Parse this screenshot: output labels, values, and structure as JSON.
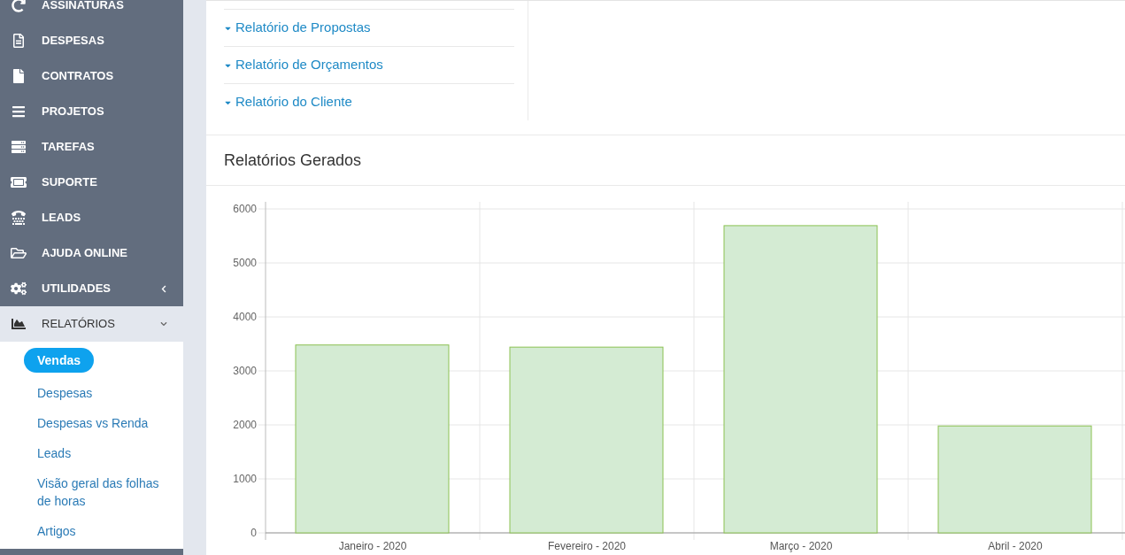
{
  "sidebar": {
    "items": [
      {
        "label": "ASSINATURAS",
        "kind": "link",
        "selected": false
      },
      {
        "label": "DESPESAS",
        "kind": "link",
        "selected": false
      },
      {
        "label": "CONTRATOS",
        "kind": "link",
        "selected": false
      },
      {
        "label": "PROJETOS",
        "kind": "link",
        "selected": false
      },
      {
        "label": "TAREFAS",
        "kind": "link",
        "selected": false
      },
      {
        "label": "SUPORTE",
        "kind": "link",
        "selected": false
      },
      {
        "label": "LEADS",
        "kind": "link",
        "selected": false
      },
      {
        "label": "AJUDA ONLINE",
        "kind": "link",
        "selected": false
      },
      {
        "label": "UTILIDADES",
        "kind": "group",
        "selected": false,
        "expanded": false
      },
      {
        "label": "RELATÓRIOS",
        "kind": "group",
        "selected": true,
        "expanded": true,
        "children": [
          {
            "label": "Vendas",
            "selected": true
          },
          {
            "label": "Despesas",
            "selected": false
          },
          {
            "label": "Despesas vs Renda",
            "selected": false
          },
          {
            "label": "Leads",
            "selected": false
          },
          {
            "label": "Visão geral das folhas de horas",
            "selected": false
          },
          {
            "label": "Artigos",
            "selected": false
          }
        ]
      }
    ]
  },
  "report_links": [
    "Relatório de Propostas",
    "Relatório de Orçamentos",
    "Relatório do Cliente"
  ],
  "generated_reports": {
    "title": "Relatórios Gerados",
    "chart_data": {
      "type": "bar",
      "categories": [
        "Janeiro - 2020",
        "Fevereiro - 2020",
        "Março - 2020",
        "Abril - 2020"
      ],
      "values": [
        3480,
        3440,
        5690,
        1980
      ],
      "grid": true,
      "ylim": [
        0,
        6000
      ],
      "yticks": [
        0,
        1000,
        2000,
        3000,
        4000,
        5000,
        6000
      ]
    }
  }
}
